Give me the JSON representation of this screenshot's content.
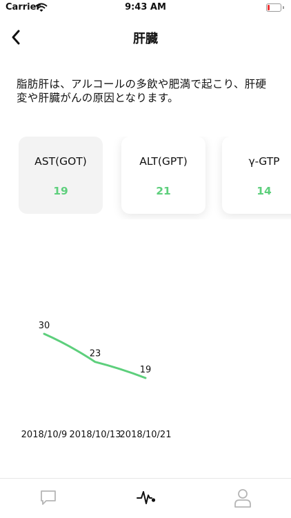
{
  "status_bar": {
    "carrier": "Carrier",
    "time": "9:43 AM"
  },
  "nav": {
    "title": "肝臓",
    "back_icon": "chevron-left-icon"
  },
  "description": "脂肪肝は、アルコールの多飲や肥満で起こり、肝硬変や肝臓がんの原因となります。",
  "cards": [
    {
      "label": "AST(GOT)",
      "value": "19",
      "selected": true
    },
    {
      "label": "ALT(GPT)",
      "value": "21",
      "selected": false
    },
    {
      "label": "γ-GTP",
      "value": "14",
      "selected": false
    }
  ],
  "colors": {
    "accent": "#5dcf7c",
    "selected_card_bg": "#f3f3f3"
  },
  "chart_data": {
    "type": "line",
    "title": "",
    "xlabel": "",
    "ylabel": "",
    "categories": [
      "2018/10/9",
      "2018/10/13",
      "2018/10/21"
    ],
    "series": [
      {
        "values": [
          30,
          23,
          19
        ],
        "color": "#5dcf7c"
      }
    ],
    "grid": false,
    "legend": "none"
  },
  "tabs": [
    {
      "name": "chat",
      "icon": "chat-bubble-icon",
      "active": false
    },
    {
      "name": "health",
      "icon": "heartbeat-icon",
      "active": true
    },
    {
      "name": "profile",
      "icon": "person-icon",
      "active": false
    }
  ]
}
